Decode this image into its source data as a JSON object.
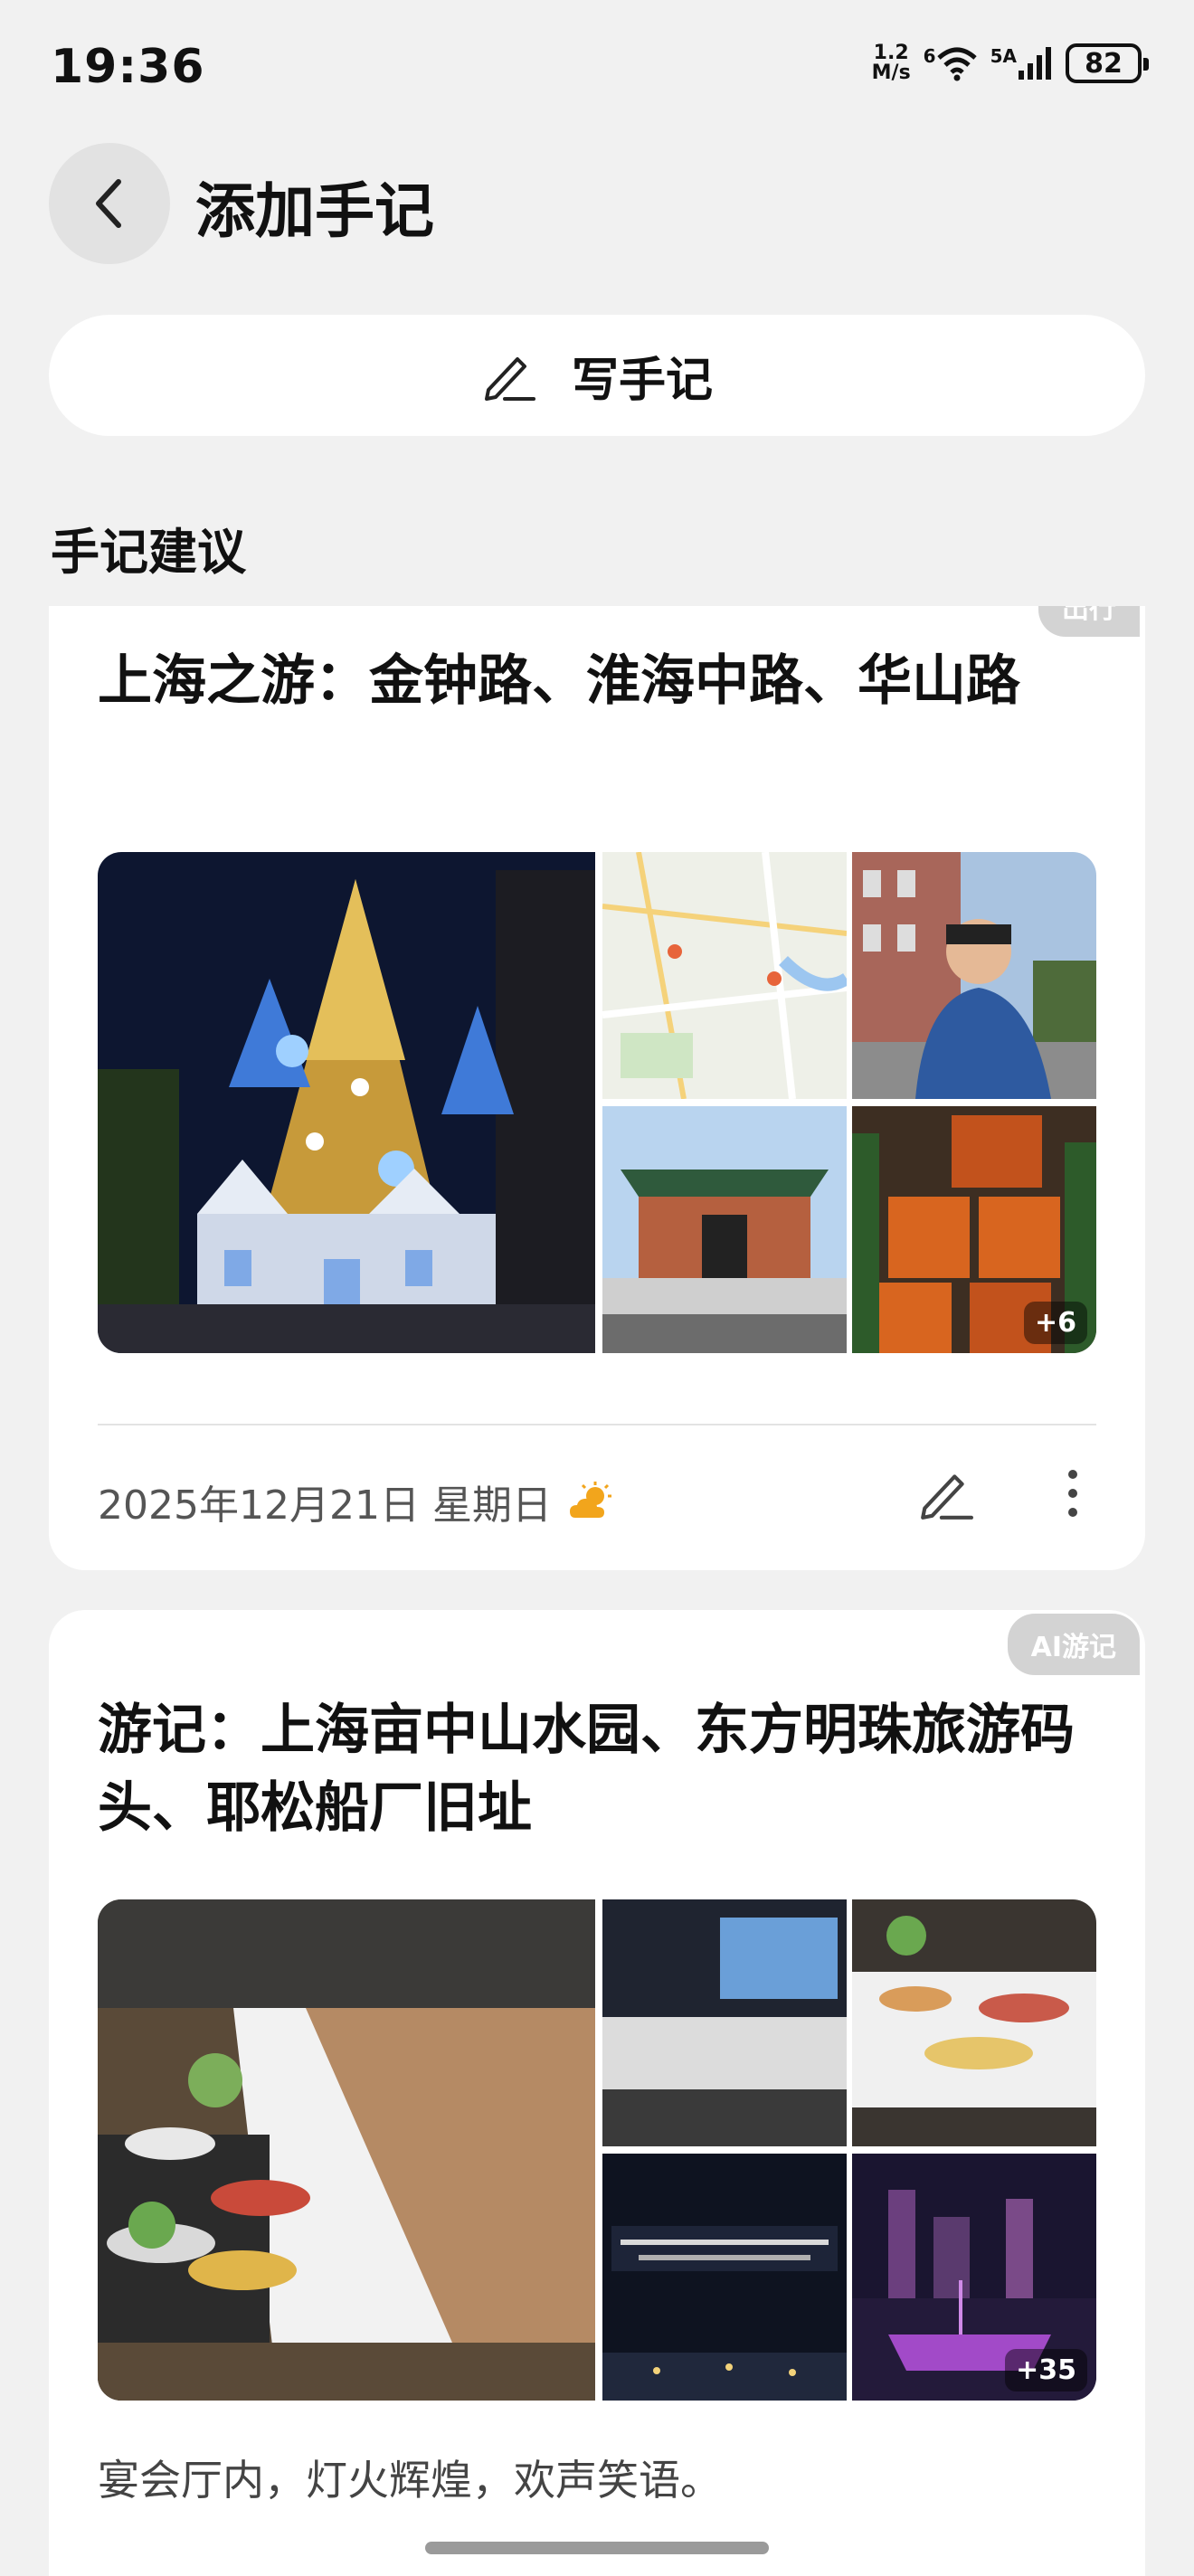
{
  "status_bar": {
    "time": "19:36",
    "speed_value": "1.2",
    "speed_unit": "M/s",
    "wifi_label": "6",
    "signal_label": "5A",
    "battery": "82"
  },
  "header": {
    "back_icon": "chevron-left-icon",
    "title": "添加手记"
  },
  "write_button": {
    "icon": "pen-icon",
    "label": "写手记"
  },
  "section_title": "手记建议",
  "cards": [
    {
      "badge": "出行",
      "title": "上海之游：金钟路、淮海中路、华山路",
      "more_count": "+6",
      "date": "2025年12月21日 星期日",
      "weather_icon": "partly-sunny-icon",
      "edit_icon": "pen-icon",
      "more_icon": "more-vertical-icon"
    },
    {
      "badge": "AI游记",
      "title": "游记：上海亩中山水园、东方明珠旅游码头、耶松船厂旧址",
      "more_count": "+35",
      "description": "宴会厅内，灯火辉煌，欢声笑语。"
    }
  ],
  "colors": {
    "background": "#f1f1f1",
    "card": "#ffffff",
    "badge": "#d3d3d3",
    "weather_accent": "#f2a51c"
  }
}
